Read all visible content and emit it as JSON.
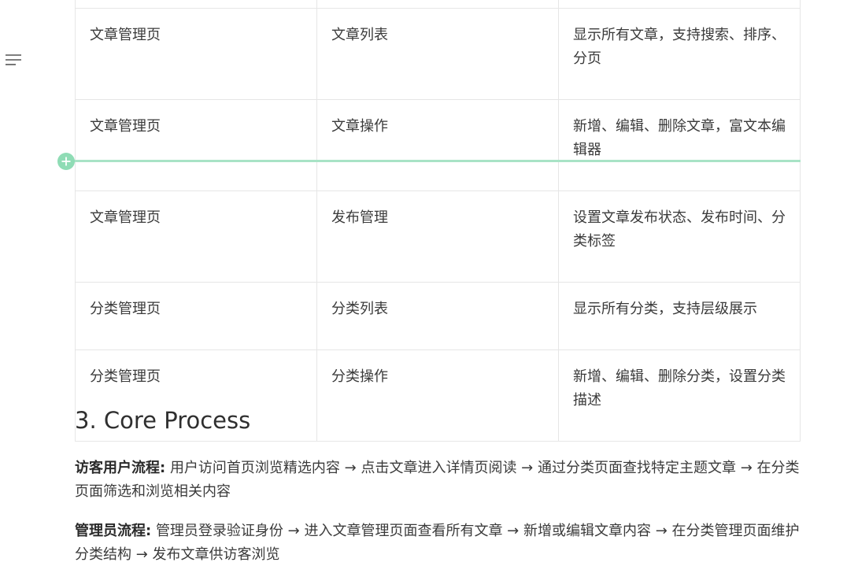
{
  "toc": {
    "icon": "outline-icon"
  },
  "table": {
    "rows": [
      {
        "page": "文章管理页",
        "feature": "文章列表",
        "desc": "显示所有文章，支持搜索、排序、分页"
      },
      {
        "page": "文章管理页",
        "feature": "文章操作",
        "desc": "新增、编辑、删除文章，富文本编辑器"
      },
      {
        "page": "文章管理页",
        "feature": "发布管理",
        "desc": "设置文章发布状态、发布时间、分类标签"
      },
      {
        "page": "分类管理页",
        "feature": "分类列表",
        "desc": "显示所有分类，支持层级展示"
      },
      {
        "page": "分类管理页",
        "feature": "分类操作",
        "desc": "新增、编辑、删除分类，设置分类描述"
      }
    ]
  },
  "insert_row": {
    "icon": "plus-circle-icon",
    "color": "#a8e3c6"
  },
  "section": {
    "title": "3. Core Process"
  },
  "flows": [
    {
      "label": "访客用户流程:",
      "text": "用户访问首页浏览精选内容 → 点击文章进入详情页阅读 → 通过分类页面查找特定主题文章 → 在分类页面筛选和浏览相关内容"
    },
    {
      "label": "管理员流程:",
      "text": "管理员登录验证身份 → 进入文章管理页面查看所有文章 → 新增或编辑文章内容 → 在分类管理页面维护分类结构 → 发布文章供访客浏览"
    }
  ]
}
